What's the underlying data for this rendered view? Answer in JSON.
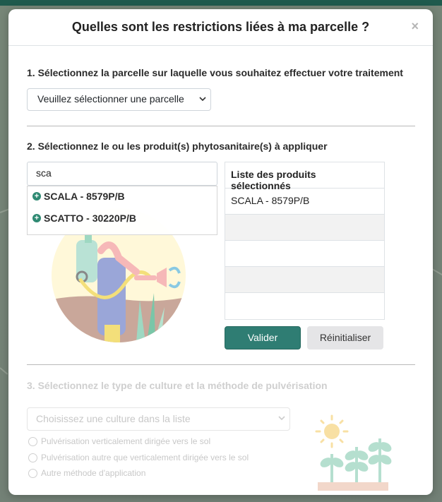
{
  "modal": {
    "title": "Quelles sont les restrictions liées à ma parcelle ?",
    "close": "×"
  },
  "step1": {
    "title": "1. Sélectionnez la parcelle sur laquelle vous souhaitez effectuer votre traitement",
    "select_value": "Veuillez sélectionner une parcelle"
  },
  "step2": {
    "title": "2. Sélectionnez le ou les produit(s) phytosanitaire(s) à appliquer",
    "search_value": "sca",
    "suggestions": [
      "SCALA - 8579P/B",
      "SCATTO - 30220P/B"
    ],
    "table_header": "Liste des produits sélectionnés",
    "selected_products": [
      "SCALA - 8579P/B",
      "",
      "",
      "",
      ""
    ],
    "validate_label": "Valider",
    "reset_label": "Réinitialiser"
  },
  "step3": {
    "title": "3. Sélectionnez le type de culture et la méthode de pulvérisation",
    "select_placeholder": "Choisissez une culture dans la liste",
    "options": [
      "Pulvérisation verticalement dirigée vers le sol",
      "Pulvérisation autre que verticalement dirigée vers le sol",
      "Autre méthode d'application"
    ]
  },
  "colors": {
    "primary": "#2f7d73",
    "header_bar": "#1f5a4d",
    "disabled_text": "#c8c8c8"
  }
}
